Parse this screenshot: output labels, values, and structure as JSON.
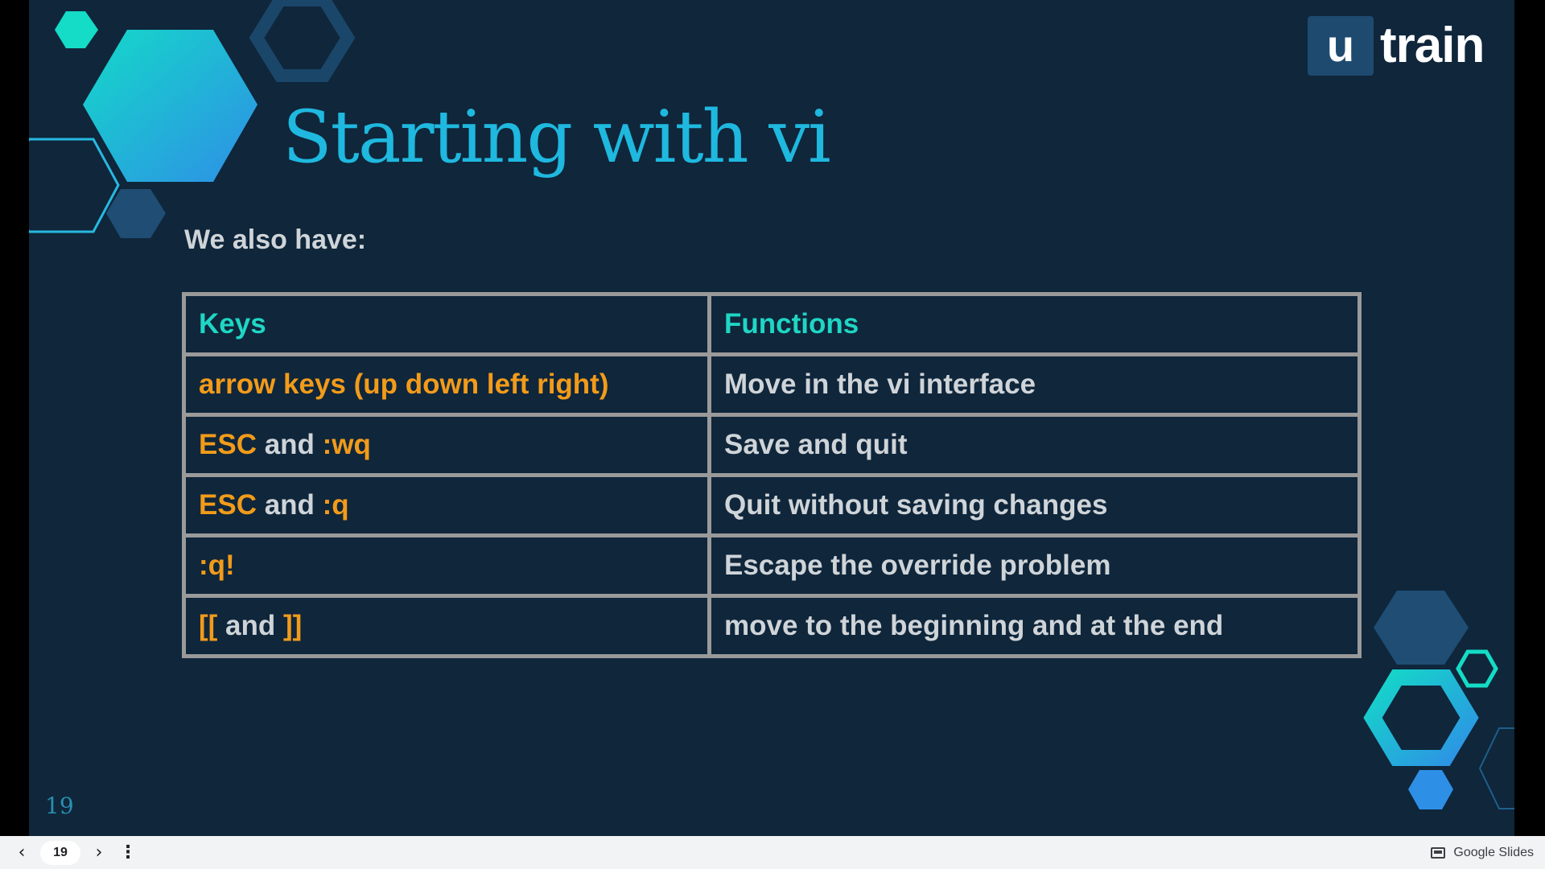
{
  "slide": {
    "logo_box_letter": "u",
    "logo_text": "train",
    "title": "Starting with vi",
    "subtitle": "We also have:",
    "table": {
      "headers": [
        "Keys",
        "Functions"
      ],
      "rows": [
        {
          "key_parts": [
            {
              "text": "arrow keys (up down left right)",
              "style": "orange"
            }
          ],
          "function": "Move in the vi interface"
        },
        {
          "key_parts": [
            {
              "text": "ESC",
              "style": "orange"
            },
            {
              "text": " and ",
              "style": "light"
            },
            {
              "text": ":wq",
              "style": "orange"
            }
          ],
          "function": "Save and quit"
        },
        {
          "key_parts": [
            {
              "text": "ESC",
              "style": "orange"
            },
            {
              "text": " and ",
              "style": "light"
            },
            {
              "text": ":q",
              "style": "orange"
            }
          ],
          "function": "Quit without saving changes"
        },
        {
          "key_parts": [
            {
              "text": ":q!",
              "style": "orange"
            }
          ],
          "function": "Escape  the override problem"
        },
        {
          "key_parts": [
            {
              "text": "[[",
              "style": "orange"
            },
            {
              "text": " and ",
              "style": "light"
            },
            {
              "text": "]]",
              "style": "orange"
            }
          ],
          "function": "move to the beginning and at the end"
        }
      ]
    },
    "slide_number": "19"
  },
  "controls": {
    "prev_icon": "chevron-left-icon",
    "page_number": "19",
    "next_icon": "chevron-right-icon",
    "more_icon": "more-vert-icon",
    "brand_label": "Google Slides"
  },
  "colors": {
    "background": "#0f263b",
    "title": "#1fb8df",
    "header_text": "#1fd6c4",
    "key_text": "#f29b1a",
    "body_text": "#cfd4d8",
    "table_border": "#9a9a9a"
  }
}
